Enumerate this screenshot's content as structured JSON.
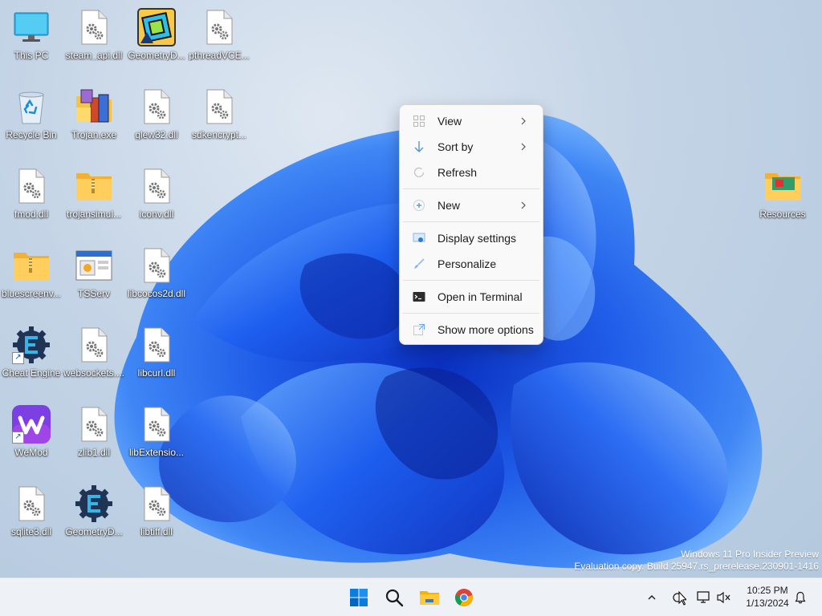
{
  "desktop": {
    "icons": [
      {
        "label": "This PC",
        "icon": "monitor-icon"
      },
      {
        "label": "steam_api.dll",
        "icon": "dll-file-icon"
      },
      {
        "label": "GeometryD...",
        "icon": "geometry-dash-icon"
      },
      {
        "label": "pthreadVCE...",
        "icon": "dll-file-icon"
      },
      {
        "label": "Recycle Bin",
        "icon": "recycle-bin-icon"
      },
      {
        "label": "Trojan.exe",
        "icon": "installer-icon"
      },
      {
        "label": "glew32.dll",
        "icon": "dll-file-icon"
      },
      {
        "label": "sdkencrypt...",
        "icon": "dll-file-icon"
      },
      {
        "label": "fmod.dll",
        "icon": "dll-file-icon"
      },
      {
        "label": "trojansimul...",
        "icon": "zip-folder-icon"
      },
      {
        "label": "iconv.dll",
        "icon": "dll-file-icon"
      },
      {
        "label": "bluescreenv...",
        "icon": "zip-folder-icon"
      },
      {
        "label": "TSServ",
        "icon": "app-window-icon"
      },
      {
        "label": "libcocos2d.dll",
        "icon": "dll-file-icon"
      },
      {
        "label": "Cheat Engine",
        "icon": "cheat-engine-icon"
      },
      {
        "label": "websockets....",
        "icon": "dll-file-icon"
      },
      {
        "label": "libcurl.dll",
        "icon": "dll-file-icon"
      },
      {
        "label": "WeMod",
        "icon": "wemod-icon"
      },
      {
        "label": "zlib1.dll",
        "icon": "dll-file-icon"
      },
      {
        "label": "libExtensio...",
        "icon": "dll-file-icon"
      },
      {
        "label": "sqlite3.dll",
        "icon": "dll-file-icon"
      },
      {
        "label": "GeometryD...",
        "icon": "cheat-engine-icon"
      },
      {
        "label": "libtiff.dll",
        "icon": "dll-file-icon"
      },
      {
        "label": "Resources",
        "icon": "folder-icon"
      }
    ],
    "watermark": {
      "line1": "Windows 11 Pro Insider Preview",
      "line2": "Evaluation copy. Build 25947.rs_prerelease.230901-1416"
    }
  },
  "context_menu": {
    "items": [
      {
        "label": "View",
        "icon": "grid-icon",
        "has_submenu": true
      },
      {
        "label": "Sort by",
        "icon": "sort-icon",
        "has_submenu": true
      },
      {
        "label": "Refresh",
        "icon": "refresh-icon",
        "has_submenu": false
      },
      {
        "label": "New",
        "icon": "plus-icon",
        "has_submenu": true
      },
      {
        "label": "Display settings",
        "icon": "display-icon",
        "has_submenu": false
      },
      {
        "label": "Personalize",
        "icon": "brush-icon",
        "has_submenu": false
      },
      {
        "label": "Open in Terminal",
        "icon": "terminal-icon",
        "has_submenu": false
      },
      {
        "label": "Show more options",
        "icon": "expand-icon",
        "has_submenu": false
      }
    ]
  },
  "taskbar": {
    "apps": [
      {
        "name": "start",
        "icon": "windows-start-icon"
      },
      {
        "name": "search",
        "icon": "search-icon"
      },
      {
        "name": "file-explorer",
        "icon": "file-explorer-icon"
      },
      {
        "name": "chrome",
        "icon": "chrome-icon"
      }
    ],
    "tray": {
      "time": "10:25 PM",
      "date": "1/13/2024"
    }
  },
  "colors": {
    "accent": "#0067c0",
    "taskbar_bg": "#eef1f6",
    "menu_bg": "#f9f9f9"
  }
}
